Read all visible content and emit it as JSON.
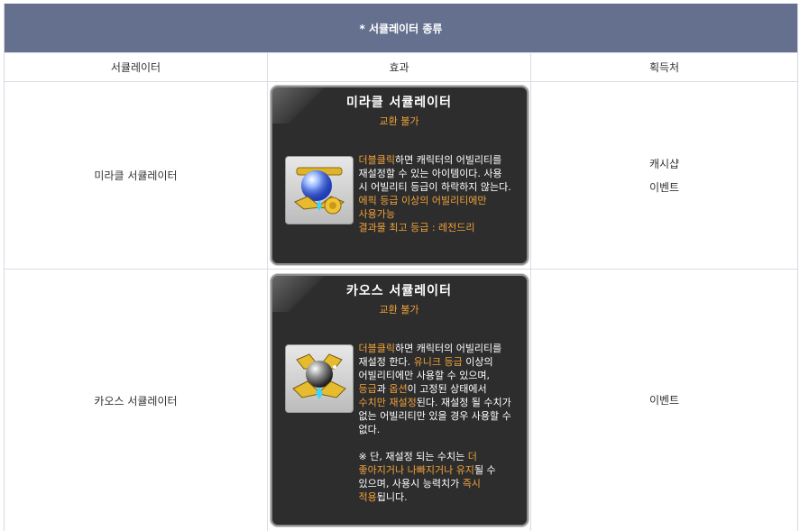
{
  "header": {
    "title": "* 서큘레이터 종류"
  },
  "columns": [
    "서큘레이터",
    "효과",
    "획득처"
  ],
  "rows": [
    {
      "name": "미라클 서큘레이터",
      "card_title": "미라클 서큘레이터",
      "card_sub": "교환 불가",
      "desc": {
        "a1": "더블클릭",
        "a2": "하면 캐릭터의 어빌리티를 재설정할 수 있는 아이템이다. 사용 시 어빌리티 등급이 하락하지 않는다.",
        "a3": "에픽 등급 이상의 어빌리티에만 사용가능",
        "a4": "결과물 최고 등급 : 레전드리"
      },
      "sources": [
        "캐시샵",
        "이벤트"
      ],
      "icon": "miracle-circulator-icon"
    },
    {
      "name": "카오스 서큘레이터",
      "card_title": "카오스 서큘레이터",
      "card_sub": "교환 불가",
      "desc": {
        "b1": "더블클릭",
        "b2": "하면 캐릭터의 어빌리티를 재설정 한다. ",
        "b3": "유니크 등급",
        "b4": " 이상의 어빌리티에만 사용할 수 있으며, ",
        "b5": "등급",
        "b6": "과 ",
        "b7": "옵션",
        "b8": "이 고정된 상태에서 ",
        "b9": "수치만 재설정",
        "b10": "된다. 재설정 될 수치가 없는 어빌리티만 있을 경우 사용할 수 없다.",
        "b11": "※ 단, 재설정 되는 수치는 ",
        "b12": "더 좋아지거나 나빠지거나 유지",
        "b13": "될 수 있으며, 사용시 능력치가 ",
        "b14": "즉시 적용",
        "b15": "됩니다."
      },
      "sources": [
        "이벤트"
      ],
      "icon": "chaos-circulator-icon"
    }
  ],
  "colors": {
    "header_bg": "#65708f",
    "accent": "#f0a13a",
    "card_bg": "#2d2d2d"
  }
}
